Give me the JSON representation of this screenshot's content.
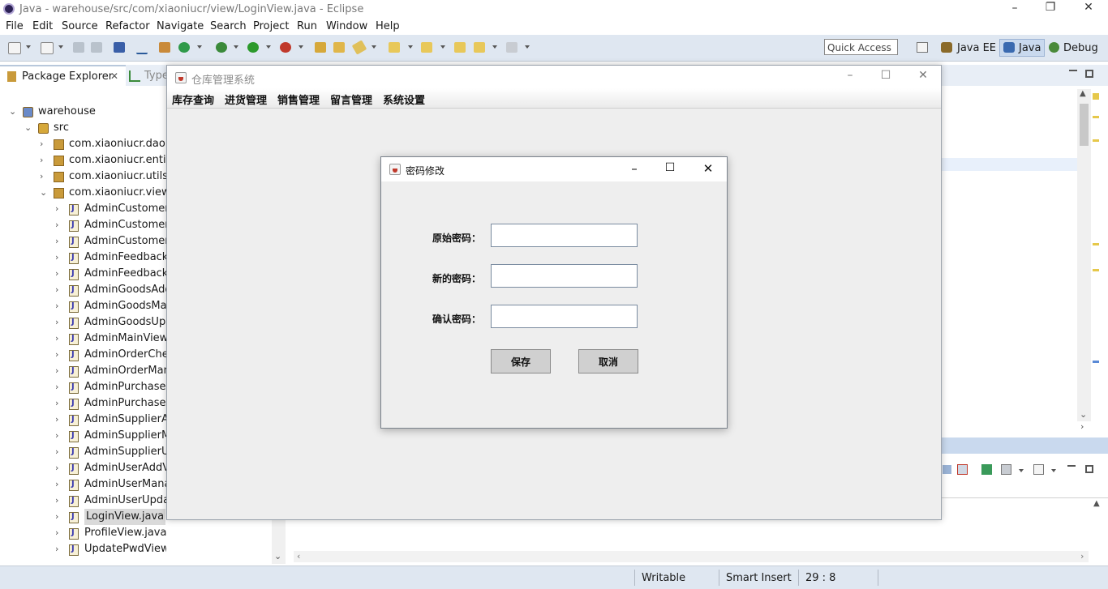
{
  "eclipse": {
    "title": "Java - warehouse/src/com/xiaoniucr/view/LoginView.java - Eclipse",
    "menu": [
      "File",
      "Edit",
      "Source",
      "Refactor",
      "Navigate",
      "Search",
      "Project",
      "Run",
      "Window",
      "Help"
    ],
    "quick_access": "Quick Access",
    "perspectives": [
      "Java EE",
      "Java",
      "Debug"
    ],
    "package_explorer_tab": "Package Explorer",
    "type_tab": "Type",
    "tree": {
      "project": "warehouse",
      "src": "src",
      "packages": [
        "com.xiaoniucr.dao",
        "com.xiaoniucr.entity",
        "com.xiaoniucr.utils",
        "com.xiaoniucr.view"
      ],
      "files": [
        "AdminCustomerA",
        "AdminCustomerM",
        "AdminCustomerU",
        "AdminFeedbackM",
        "AdminFeedbackR",
        "AdminGoodsAdd",
        "AdminGoodsMan",
        "AdminGoodsUpd",
        "AdminMainView.j",
        "AdminOrderChec",
        "AdminOrderMana",
        "AdminPurchaseC",
        "AdminPurchaseM",
        "AdminSupplierAd",
        "AdminSupplierMa",
        "AdminSupplierUp",
        "AdminUserAddVi",
        "AdminUserManag",
        "AdminUserUpdat",
        "LoginView.java",
        "ProfileView.java",
        "UpdatePwdView.java"
      ]
    },
    "status": {
      "writable": "Writable",
      "insert": "Smart Insert",
      "position": "29 : 8"
    }
  },
  "frame": {
    "title": "仓库管理系统",
    "menu": [
      "库存查询",
      "进货管理",
      "销售管理",
      "留言管理",
      "系统设置"
    ]
  },
  "dialog": {
    "title": "密码修改",
    "fields": [
      {
        "label": "原始密码：",
        "value": ""
      },
      {
        "label": "新的密码：",
        "value": ""
      },
      {
        "label": "确认密码：",
        "value": ""
      }
    ],
    "save_label": "保存",
    "cancel_label": "取消"
  }
}
